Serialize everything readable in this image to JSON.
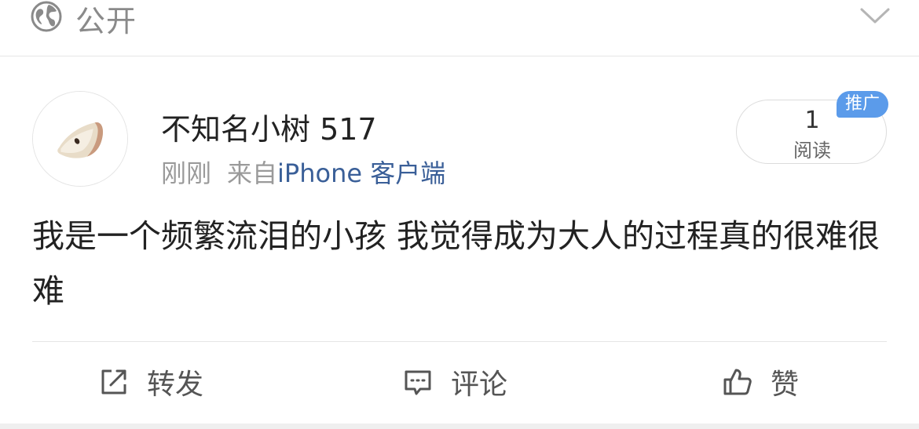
{
  "header": {
    "visibility_label": "公开",
    "visibility_icon": "globe-icon",
    "expand_icon": "chevron-down-icon"
  },
  "post": {
    "username": "不知名小树 517",
    "time": "刚刚",
    "source_prefix": "来自",
    "source": "iPhone 客户端",
    "content": "我是一个频繁流泪的小孩 我觉得成为大人的过程真的很难很难",
    "read_count": "1",
    "read_label": "阅读",
    "promo_badge": "推广"
  },
  "actions": {
    "repost_label": "转发",
    "comment_label": "评论",
    "like_label": "赞"
  },
  "colors": {
    "accent_link": "#3a5f98",
    "badge": "#5b9bea",
    "muted_text": "#9a9a9a"
  }
}
